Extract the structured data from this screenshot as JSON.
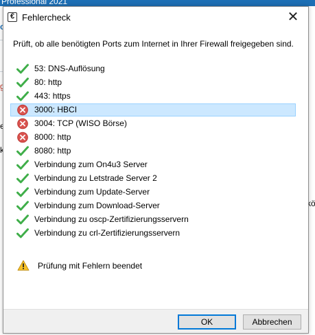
{
  "background": {
    "window_title": "Professional 2021",
    "fragments": {
      "c": "c",
      "g": "g",
      "e": "e",
      "k": "k",
      "trailing": "kö"
    }
  },
  "dialog": {
    "title": "Fehlercheck",
    "app_icon_glyph": "€",
    "close_glyph": "✕",
    "intro": "Prüft, ob alle benötigten Ports zum Internet in Ihrer Firewall freigegeben sind.",
    "checks": [
      {
        "label": "53: DNS-Auflösung",
        "status": "ok"
      },
      {
        "label": "80: http",
        "status": "ok"
      },
      {
        "label": "443: https",
        "status": "ok"
      },
      {
        "label": "3000: HBCI",
        "status": "error",
        "selected": true
      },
      {
        "label": "3004: TCP (WISO Börse)",
        "status": "error"
      },
      {
        "label": "8000: http",
        "status": "error"
      },
      {
        "label": "8080: http",
        "status": "ok"
      },
      {
        "label": "Verbindung zum On4u3 Server",
        "status": "ok"
      },
      {
        "label": "Verbindung zu Letstrade Server 2",
        "status": "ok"
      },
      {
        "label": "Verbindung zum Update-Server",
        "status": "ok"
      },
      {
        "label": "Verbindung zum Download-Server",
        "status": "ok"
      },
      {
        "label": "Verbindung zu oscp-Zertifizierungsservern",
        "status": "ok"
      },
      {
        "label": "Verbindung zu crl-Zertifizierungsservern",
        "status": "ok"
      }
    ],
    "summary": {
      "icon": "warning-icon",
      "text": "Prüfung mit Fehlern beendet"
    },
    "buttons": {
      "ok": "OK",
      "cancel": "Abbrechen"
    }
  },
  "colors": {
    "ok": "#3fae49",
    "error": "#d9534f",
    "warning": "#f6c026",
    "selection": "#cce8ff",
    "accent": "#0078d7"
  }
}
